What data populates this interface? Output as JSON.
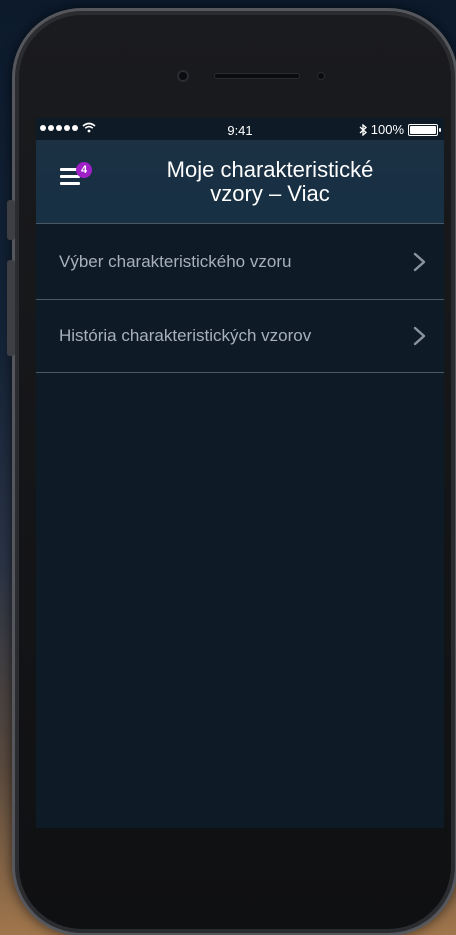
{
  "statusbar": {
    "time": "9:41",
    "battery": "100%",
    "wifi_icon": "wifi-icon",
    "bluetooth_icon": "bluetooth-icon",
    "battery_level": 1.0
  },
  "header": {
    "title_line1": "Moje charakteristické",
    "title_line2": "vzory – Viac",
    "menu_icon": "hamburger-menu-icon",
    "badge_count": "4",
    "badge_color": "#a020c8"
  },
  "menu": {
    "items": [
      {
        "label": "Výber charakteristického vzoru"
      },
      {
        "label": "História charakteristických vzorov"
      }
    ]
  },
  "colors": {
    "nav_bg": "#1b3043",
    "screen_bg": "#0f1a27",
    "item_text": "#a7b0bb",
    "divider": "#4a5868"
  }
}
